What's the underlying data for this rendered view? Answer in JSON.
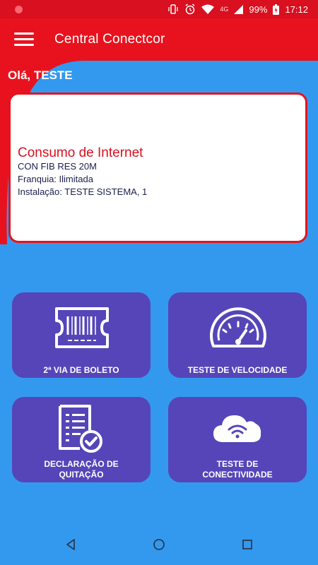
{
  "status_bar": {
    "network": "4G",
    "battery": "99%",
    "time": "17:12",
    "icons": [
      "notification-dot-icon",
      "vibrate-icon",
      "alarm-icon",
      "wifi-icon",
      "signal-icon",
      "battery-charging-icon"
    ]
  },
  "app_bar": {
    "title": "Central Conectcor",
    "menu_icon": "hamburger-menu-icon"
  },
  "greeting": "Olá, TESTE",
  "card": {
    "title": "Consumo de Internet",
    "plan": "CON FIB RES 20M",
    "franchise": "Franquia: Ilimitada",
    "installation": "Instalação: TESTE SISTEMA, 1"
  },
  "tiles": [
    {
      "label_line1": "2ª VIA DE BOLETO",
      "label_line2": "",
      "icon": "barcode-ticket-icon"
    },
    {
      "label_line1": "TESTE DE VELOCIDADE",
      "label_line2": "",
      "icon": "speedometer-icon"
    },
    {
      "label_line1": "DECLARAÇÃO DE",
      "label_line2": "QUITAÇÃO",
      "icon": "document-check-icon"
    },
    {
      "label_line1": "TESTE DE",
      "label_line2": "CONECTIVIDADE",
      "icon": "cloud-wifi-icon"
    }
  ],
  "nav_bar": {
    "icons": [
      "back-icon",
      "home-icon",
      "recents-icon"
    ]
  },
  "colors": {
    "primary_red": "#e8121e",
    "background_blue": "#3399ee",
    "tile_purple": "#5545b8",
    "card_text": "#1a1f4c"
  }
}
